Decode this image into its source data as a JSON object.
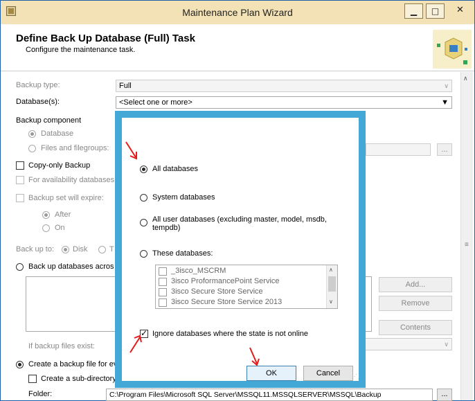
{
  "window": {
    "title": "Maintenance Plan Wizard",
    "minimize_glyph": "▁",
    "maximize_glyph": "□",
    "close_glyph": "✕"
  },
  "header": {
    "title": "Define Back Up Database (Full) Task",
    "subtitle": "Configure the maintenance task."
  },
  "form": {
    "backup_type_label": "Backup type:",
    "backup_type_value": "Full",
    "databases_label": "Database(s):",
    "databases_value": "<Select one or more>",
    "backup_component_label": "Backup component",
    "component_database": "Database",
    "component_files": "Files and filegroups:",
    "copy_only": "Copy-only Backup",
    "availability": "For availability databases,",
    "backup_set_expire": "Backup set will expire:",
    "after": "After",
    "on": "On",
    "back_up_to": "Back up to:",
    "disk": "Disk",
    "tape_initial": "T",
    "back_up_across": "Back up databases acros",
    "if_backup_exists": "If backup files exist:",
    "create_backup_file": "Create a backup file for ev",
    "create_subdir": "Create a sub-directory",
    "folder_label": "Folder:",
    "folder_value": "C:\\Program Files\\Microsoft SQL Server\\MSSQL11.MSSQLSERVER\\MSSQL\\Backup",
    "browse_label": "...",
    "add_label": "Add...",
    "remove_label": "Remove",
    "contents_label": "Contents"
  },
  "dialog": {
    "all_databases": "All databases",
    "system_databases": "System databases",
    "all_user_databases_line1": "All user databases  (excluding master, model, msdb,",
    "all_user_databases_line2": "tempdb)",
    "these_databases": "These databases:",
    "database_list": [
      "_3isco_MSCRM",
      "3isco ProformancePoint Service",
      "3isco Secure Store Service",
      "3isco Secure Store Service 2013"
    ],
    "ignore_offline": "Ignore databases where the state is not online",
    "ok_label": "OK",
    "cancel_label": "Cancel",
    "selected_option": "All databases"
  },
  "colors": {
    "titlebar": "#f2e2b6",
    "dialog_border": "#44a8d6",
    "annotation_arrow": "#e21b1b"
  }
}
